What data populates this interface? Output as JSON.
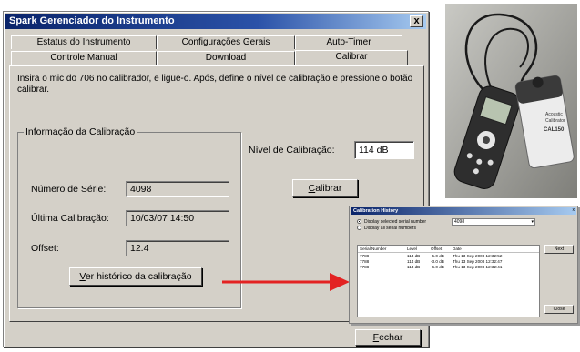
{
  "window": {
    "title": "Spark Gerenciador do Instrumento",
    "close_label": "x"
  },
  "tabs_back": [
    "Estatus do Instrumento",
    "Configurações Gerais",
    "Auto-Timer"
  ],
  "tabs_front": [
    "Controle Manual",
    "Download",
    "Calibrar"
  ],
  "active_tab": "Calibrar",
  "instruction": "Insira o mic do 706 no calibrador, e ligue-o.  Após, define o nível de calibração e pressione o botão calibrar.",
  "calibration_info": {
    "group_title": "Informação da Calibração",
    "serial_label": "Número de Série:",
    "serial_value": "4098",
    "last_cal_label": "Última Calibração:",
    "last_cal_value": "10/03/07 14:50",
    "offset_label": "Offset:",
    "offset_value": "12.4",
    "history_button_u": "V",
    "history_button_rest": "er histórico da calibração"
  },
  "calibration_level": {
    "label": "Nível de Calibração:",
    "value": "114 dB"
  },
  "calibrate_button": {
    "u": "C",
    "rest": "alibrar"
  },
  "close_button": {
    "u": "F",
    "rest": "echar"
  },
  "photo": {
    "calibrator_text_1": "Acoustic",
    "calibrator_text_2": "Calibrator",
    "calibrator_model": "CAL150"
  },
  "history_window": {
    "title": "Calibration History",
    "close_label": "x",
    "radio_selected_label": "Display selected serial number",
    "radio_all_label": "Display all serial numbers",
    "serial_select_value": "4098",
    "columns": [
      "Serial Number",
      "Level",
      "Offset",
      "Date"
    ],
    "rows": [
      [
        "7788",
        "114 dB",
        "-5.0 dB",
        "Thu 13 Sep 2008 12:32:52"
      ],
      [
        "7788",
        "114 dB",
        "-3.0 dB",
        "Thu 13 Sep 2008 12:32:47"
      ],
      [
        "7788",
        "114 dB",
        "-6.0 dB",
        "Thu 13 Sep 2008 12:32:41"
      ]
    ],
    "next_label": "Next",
    "close_button_label": "Close"
  },
  "colors": {
    "dialog_bg": "#d4d0c8",
    "title_bar": "#0a246a",
    "arrow": "#e32222"
  }
}
